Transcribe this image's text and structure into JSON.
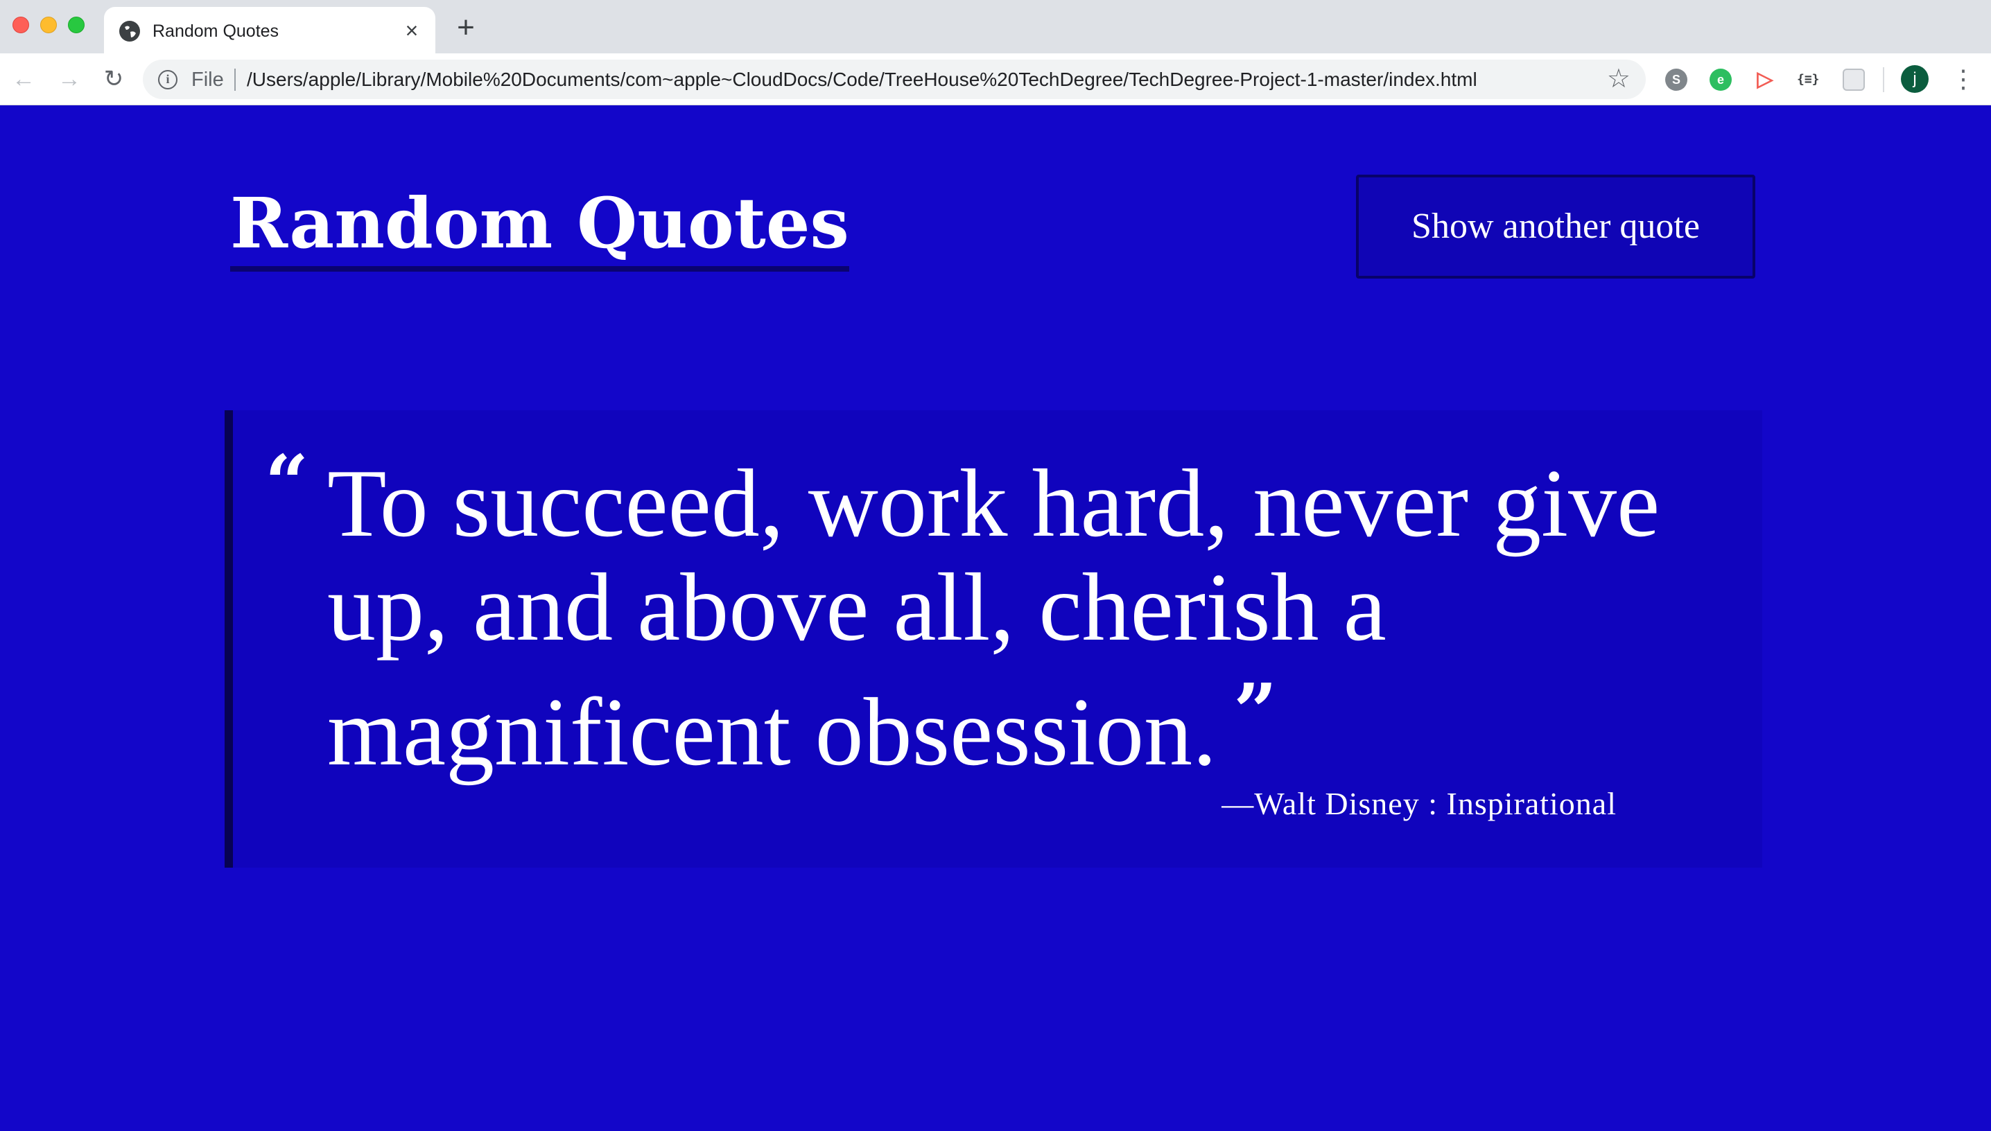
{
  "browser": {
    "tab_title": "Random Quotes",
    "tab_close": "×",
    "new_tab": "+",
    "nav_back": "←",
    "nav_forward": "→",
    "nav_reload": "↻",
    "info_glyph": "i",
    "scheme_label": "File",
    "url": "/Users/apple/Library/Mobile%20Documents/com~apple~CloudDocs/Code/TreeHouse%20TechDegree/TechDegree-Project-1-master/index.html",
    "bookmark_glyph": "☆",
    "extensions": {
      "skype": "S",
      "evernote": "e",
      "cast": "▷",
      "json": "{≡}",
      "grid": ""
    },
    "avatar_initial": "j",
    "menu_glyph": "⋮"
  },
  "page": {
    "title": "Random Quotes",
    "load_button_label": "Show another quote",
    "quote": {
      "open_mark": "“",
      "text": "To succeed, work hard, never give up, and above all, cherish a magnificent obsession.",
      "close_mark": "”",
      "attribution": "—Walt Disney : Inspirational"
    }
  },
  "colors": {
    "page_background": "#1306c9",
    "quote_box_background": "#1004bd",
    "accent_border": "#070253",
    "text": "#ffffff"
  }
}
